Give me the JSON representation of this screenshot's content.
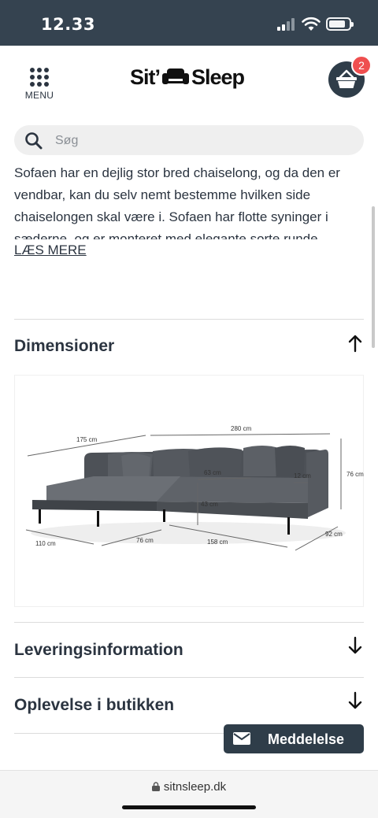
{
  "status": {
    "time": "12.33"
  },
  "header": {
    "menu_label": "MENU",
    "logo_left": "Sit’",
    "logo_right": "Sleep",
    "cart_count": "2"
  },
  "search": {
    "placeholder": "Søg"
  },
  "description": {
    "text": "Sofaen har en dejlig stor bred chaiselong, og da den er vendbar, kan du selv nemt bestemme hvilken side chaiselongen skal være i. Sofaen har flotte syninger i sæderne, og er monteret med elegante sorte runde",
    "read_more": "LÆS MERE"
  },
  "sections": {
    "dimensions": "Dimensioner",
    "delivery": "Leveringsinformation",
    "store": "Oplevelse i butikken"
  },
  "dimensions_image": {
    "labels": [
      "175 cm",
      "280 cm",
      "63 cm",
      "12 cm",
      "76 cm",
      "43 cm",
      "110 cm",
      "76 cm",
      "158 cm",
      "92 cm"
    ]
  },
  "chat": {
    "label": "Meddelelse"
  },
  "browser": {
    "url": "sitnsleep.dk"
  },
  "colors": {
    "dark": "#2f3d49",
    "badge": "#ef4f4f",
    "status_bar": "#354350"
  }
}
